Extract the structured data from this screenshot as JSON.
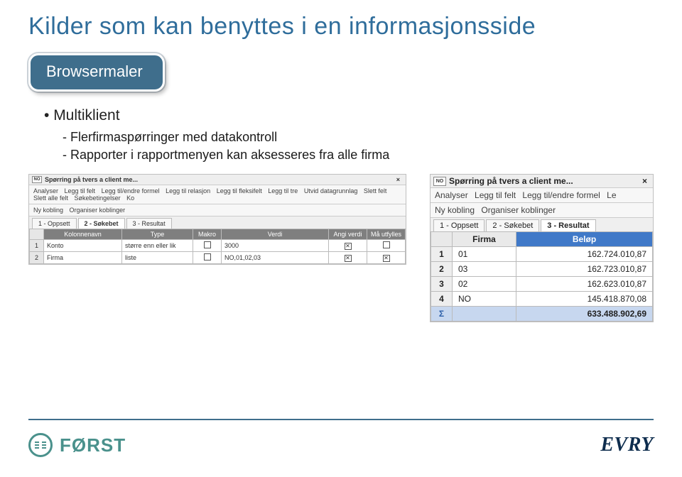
{
  "title": "Kilder som kan benyttes i en informasjonsside",
  "pill": "Browsermaler",
  "bullet1": "Multiklient",
  "sub1": "Flerfirmaspørringer med datakontroll",
  "sub2": "Rapporter i rapportmenyen kan aksesseres fra alle firma",
  "left": {
    "flag": "NO",
    "title": "Spørring på tvers a client me...",
    "close": "×",
    "tb1": {
      "a": "Analyser",
      "b": "Legg til felt",
      "c": "Legg til/endre formel",
      "d": "Legg til relasjon",
      "e": "Legg til fleksifelt",
      "f": "Legg til tre",
      "g": "Utvid datagrunnlag",
      "h": "Slett felt",
      "i": "Slett alle felt",
      "j": "Søkebetingelser",
      "k": "Ko"
    },
    "tb2": {
      "a": "Ny kobling",
      "b": "Organiser koblinger"
    },
    "tabs": {
      "t1": "1 - Oppsett",
      "t2": "2 - Søkebet",
      "t3": "3 - Resultat"
    },
    "hdr": {
      "c0": "",
      "c1": "Kolonnenavn",
      "c2": "Type",
      "c3": "Makro",
      "c4": "Verdi",
      "c5": "Angi verdi",
      "c6": "Må utfylles"
    },
    "rows": [
      {
        "n": "1",
        "c1": "Konto",
        "c2": "større enn eller lik",
        "c3_chk": false,
        "c4": "3000",
        "c5_chk": true,
        "c6_chk": false
      },
      {
        "n": "2",
        "c1": "Firma",
        "c2": "liste",
        "c3_chk": false,
        "c4": "NO,01,02,03",
        "c5_chk": true,
        "c6_chk": true
      }
    ]
  },
  "right": {
    "flag": "NO",
    "title": "Spørring på tvers a client me...",
    "close": "×",
    "tb1": {
      "a": "Analyser",
      "b": "Legg til felt",
      "c": "Legg til/endre formel",
      "d": "Le"
    },
    "tb2": {
      "a": "Ny kobling",
      "b": "Organiser koblinger"
    },
    "tabs": {
      "t1": "1 - Oppsett",
      "t2": "2 - Søkebet",
      "t3": "3 - Resultat"
    },
    "hdr": {
      "c1": "Firma",
      "c2": "Beløp"
    },
    "rows": [
      {
        "n": "1",
        "firma": "01",
        "belop": "162.724.010,87"
      },
      {
        "n": "2",
        "firma": "03",
        "belop": "162.723.010,87"
      },
      {
        "n": "3",
        "firma": "02",
        "belop": "162.623.010,87"
      },
      {
        "n": "4",
        "firma": "NO",
        "belop": "145.418.870,08"
      }
    ],
    "sum": {
      "sym": "Σ",
      "belop": "633.488.902,69"
    }
  },
  "footer": {
    "forst": "FØRST",
    "evry": "EVRY"
  }
}
